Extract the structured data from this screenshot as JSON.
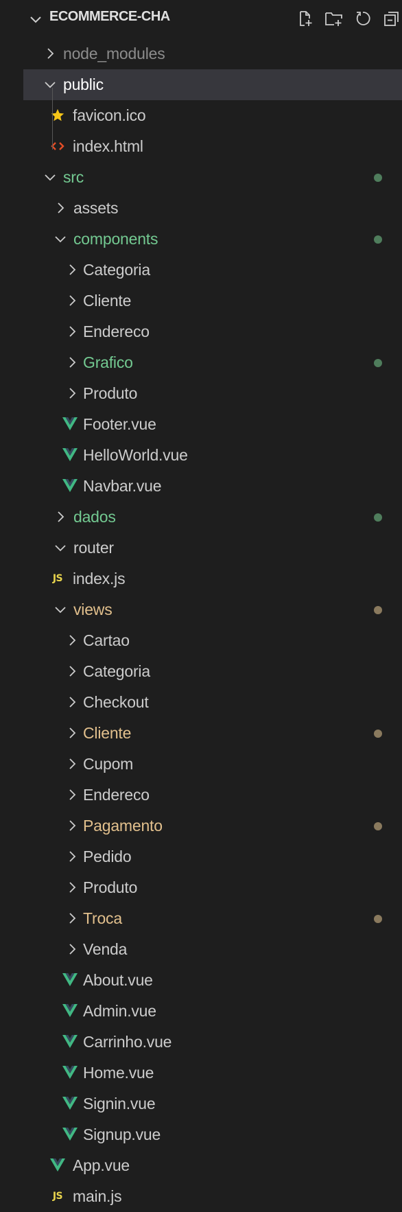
{
  "explorer": {
    "title": "ECOMMERCE-CHA",
    "actions": [
      {
        "name": "new-file-icon"
      },
      {
        "name": "new-folder-icon"
      },
      {
        "name": "refresh-icon"
      },
      {
        "name": "collapse-all-icon"
      }
    ]
  },
  "colors": {
    "default_text": "#cccccc",
    "modified_green": "#73c991",
    "modified_orange": "#e2c08d",
    "dim_text": "#8c8c8c",
    "selected_bg": "#37373d",
    "vue_green": "#41b883",
    "html_orange": "#e44d26",
    "favicon_yellow": "#f5c518",
    "dot_green": "#4f7d5c",
    "dot_brown": "#8a7a5e",
    "js_yellow": "#e8d44d"
  },
  "tree": [
    {
      "label": "node_modules",
      "depth": 0,
      "kind": "folder",
      "expanded": false,
      "tone": "dim",
      "dot": ""
    },
    {
      "label": "public",
      "depth": 0,
      "kind": "folder",
      "expanded": true,
      "tone": "default",
      "dot": "",
      "selected": true
    },
    {
      "label": "favicon.ico",
      "depth": 1,
      "kind": "file",
      "icon": "star-icon",
      "tone": "default",
      "dot": ""
    },
    {
      "label": "index.html",
      "depth": 1,
      "kind": "file",
      "icon": "html-icon",
      "tone": "default",
      "dot": ""
    },
    {
      "label": "src",
      "depth": 0,
      "kind": "folder",
      "expanded": true,
      "tone": "green",
      "dot": "green"
    },
    {
      "label": "assets",
      "depth": 1,
      "kind": "folder",
      "expanded": false,
      "tone": "default",
      "dot": ""
    },
    {
      "label": "components",
      "depth": 1,
      "kind": "folder",
      "expanded": true,
      "tone": "green",
      "dot": "green"
    },
    {
      "label": "Categoria",
      "depth": 2,
      "kind": "folder",
      "expanded": false,
      "tone": "default",
      "dot": ""
    },
    {
      "label": "Cliente",
      "depth": 2,
      "kind": "folder",
      "expanded": false,
      "tone": "default",
      "dot": ""
    },
    {
      "label": "Endereco",
      "depth": 2,
      "kind": "folder",
      "expanded": false,
      "tone": "default",
      "dot": ""
    },
    {
      "label": "Grafico",
      "depth": 2,
      "kind": "folder",
      "expanded": false,
      "tone": "green",
      "dot": "green"
    },
    {
      "label": "Produto",
      "depth": 2,
      "kind": "folder",
      "expanded": false,
      "tone": "default",
      "dot": ""
    },
    {
      "label": "Footer.vue",
      "depth": 2,
      "kind": "file",
      "icon": "vue-icon",
      "tone": "default",
      "dot": ""
    },
    {
      "label": "HelloWorld.vue",
      "depth": 2,
      "kind": "file",
      "icon": "vue-icon",
      "tone": "default",
      "dot": ""
    },
    {
      "label": "Navbar.vue",
      "depth": 2,
      "kind": "file",
      "icon": "vue-icon",
      "tone": "default",
      "dot": ""
    },
    {
      "label": "dados",
      "depth": 1,
      "kind": "folder",
      "expanded": false,
      "tone": "green",
      "dot": "green"
    },
    {
      "label": "router",
      "depth": 1,
      "kind": "folder",
      "expanded": true,
      "tone": "default",
      "dot": ""
    },
    {
      "label": "index.js",
      "depth": 1,
      "kind": "file",
      "icon": "js-icon",
      "tone": "default",
      "dot": ""
    },
    {
      "label": "views",
      "depth": 1,
      "kind": "folder",
      "expanded": true,
      "tone": "orange",
      "dot": "brown"
    },
    {
      "label": "Cartao",
      "depth": 2,
      "kind": "folder",
      "expanded": false,
      "tone": "default",
      "dot": ""
    },
    {
      "label": "Categoria",
      "depth": 2,
      "kind": "folder",
      "expanded": false,
      "tone": "default",
      "dot": ""
    },
    {
      "label": "Checkout",
      "depth": 2,
      "kind": "folder",
      "expanded": false,
      "tone": "default",
      "dot": ""
    },
    {
      "label": "Cliente",
      "depth": 2,
      "kind": "folder",
      "expanded": false,
      "tone": "orange",
      "dot": "brown"
    },
    {
      "label": "Cupom",
      "depth": 2,
      "kind": "folder",
      "expanded": false,
      "tone": "default",
      "dot": ""
    },
    {
      "label": "Endereco",
      "depth": 2,
      "kind": "folder",
      "expanded": false,
      "tone": "default",
      "dot": ""
    },
    {
      "label": "Pagamento",
      "depth": 2,
      "kind": "folder",
      "expanded": false,
      "tone": "orange",
      "dot": "brown"
    },
    {
      "label": "Pedido",
      "depth": 2,
      "kind": "folder",
      "expanded": false,
      "tone": "default",
      "dot": ""
    },
    {
      "label": "Produto",
      "depth": 2,
      "kind": "folder",
      "expanded": false,
      "tone": "default",
      "dot": ""
    },
    {
      "label": "Troca",
      "depth": 2,
      "kind": "folder",
      "expanded": false,
      "tone": "orange",
      "dot": "brown"
    },
    {
      "label": "Venda",
      "depth": 2,
      "kind": "folder",
      "expanded": false,
      "tone": "default",
      "dot": ""
    },
    {
      "label": "About.vue",
      "depth": 2,
      "kind": "file",
      "icon": "vue-icon",
      "tone": "default",
      "dot": ""
    },
    {
      "label": "Admin.vue",
      "depth": 2,
      "kind": "file",
      "icon": "vue-icon",
      "tone": "default",
      "dot": ""
    },
    {
      "label": "Carrinho.vue",
      "depth": 2,
      "kind": "file",
      "icon": "vue-icon",
      "tone": "default",
      "dot": ""
    },
    {
      "label": "Home.vue",
      "depth": 2,
      "kind": "file",
      "icon": "vue-icon",
      "tone": "default",
      "dot": ""
    },
    {
      "label": "Signin.vue",
      "depth": 2,
      "kind": "file",
      "icon": "vue-icon",
      "tone": "default",
      "dot": ""
    },
    {
      "label": "Signup.vue",
      "depth": 2,
      "kind": "file",
      "icon": "vue-icon",
      "tone": "default",
      "dot": ""
    },
    {
      "label": "App.vue",
      "depth": 1,
      "kind": "file",
      "icon": "vue-icon",
      "tone": "default",
      "dot": ""
    },
    {
      "label": "main.js",
      "depth": 1,
      "kind": "file",
      "icon": "js-icon",
      "tone": "default",
      "dot": ""
    }
  ]
}
